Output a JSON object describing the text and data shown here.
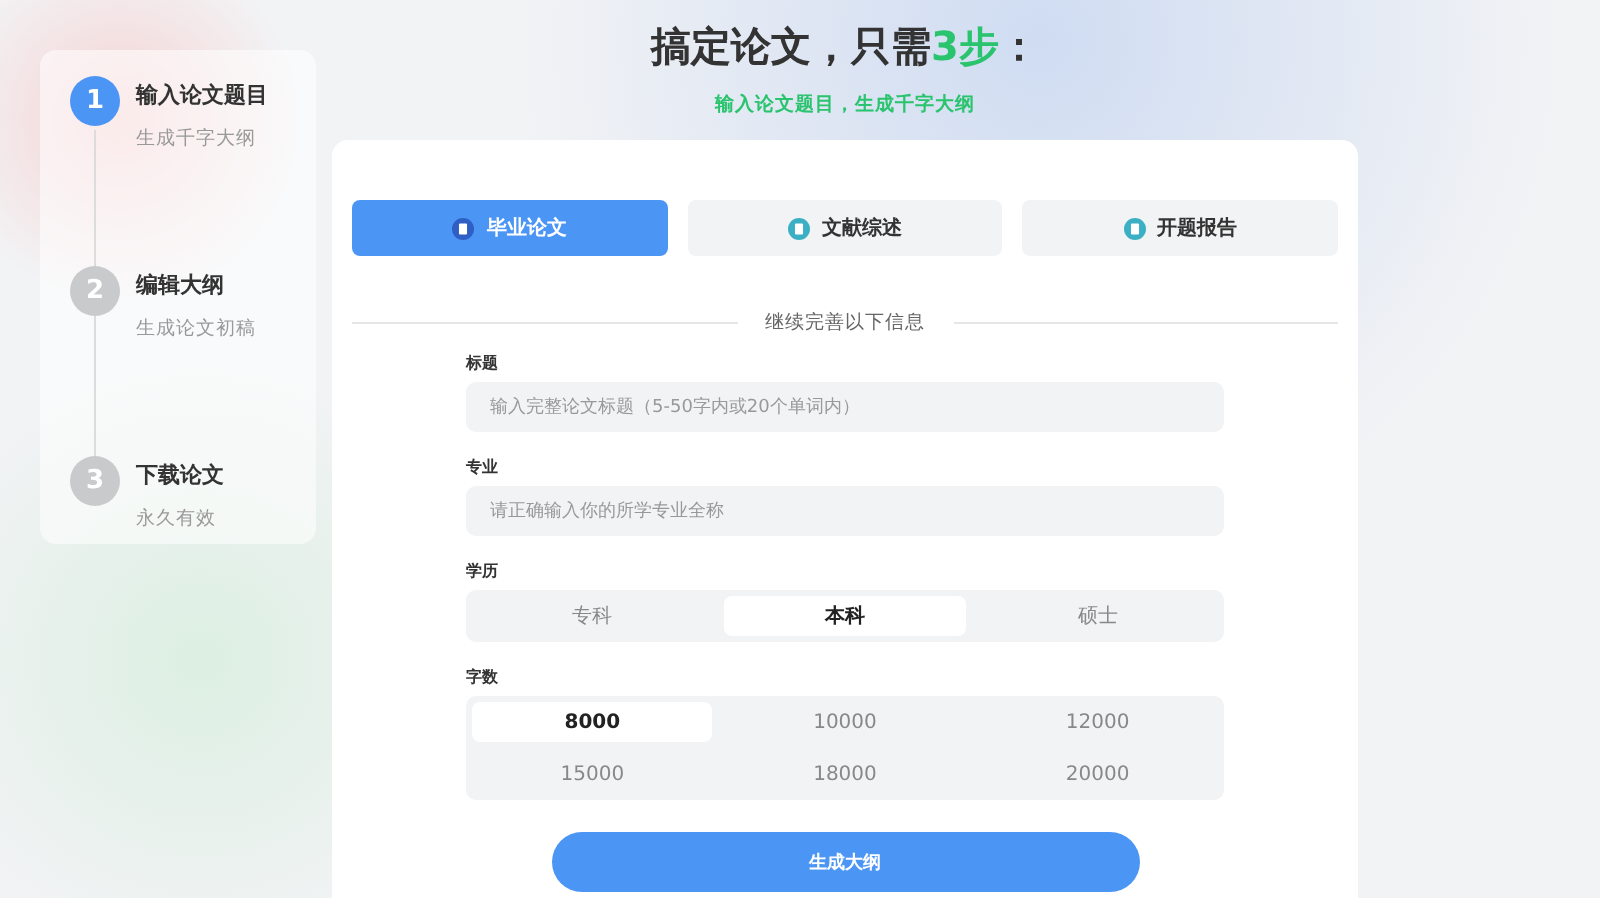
{
  "steps": [
    {
      "number": "1",
      "title": "输入论文题目",
      "subtitle": "生成千字大纲",
      "active": true
    },
    {
      "number": "2",
      "title": "编辑大纲",
      "subtitle": "生成论文初稿",
      "active": false
    },
    {
      "number": "3",
      "title": "下载论文",
      "subtitle": "永久有效",
      "active": false
    }
  ],
  "header": {
    "title_before": "搞定论文，只需",
    "title_highlight": "3步",
    "title_after": "：",
    "subtitle": "输入论文题目，生成千字大纲"
  },
  "tabs": [
    {
      "label": "毕业论文",
      "selected": true
    },
    {
      "label": "文献综述",
      "selected": false
    },
    {
      "label": "开题报告",
      "selected": false
    }
  ],
  "divider_text": "继续完善以下信息",
  "fields": [
    {
      "label": "标题",
      "placeholder": "输入完整论文标题（5-50字内或20个单词内）"
    },
    {
      "label": "专业",
      "placeholder": "请正确输入你的所学专业全称"
    }
  ],
  "degree": {
    "label": "学历",
    "options": [
      {
        "label": "专科",
        "selected": false
      },
      {
        "label": "本科",
        "selected": true
      },
      {
        "label": "硕士",
        "selected": false
      }
    ]
  },
  "word_count": {
    "label": "字数",
    "options": [
      {
        "label": "8000",
        "selected": true
      },
      {
        "label": "10000",
        "selected": false
      },
      {
        "label": "12000",
        "selected": false
      },
      {
        "label": "15000",
        "selected": false
      },
      {
        "label": "18000",
        "selected": false
      },
      {
        "label": "20000",
        "selected": false
      }
    ]
  },
  "submit": "生成大纲"
}
